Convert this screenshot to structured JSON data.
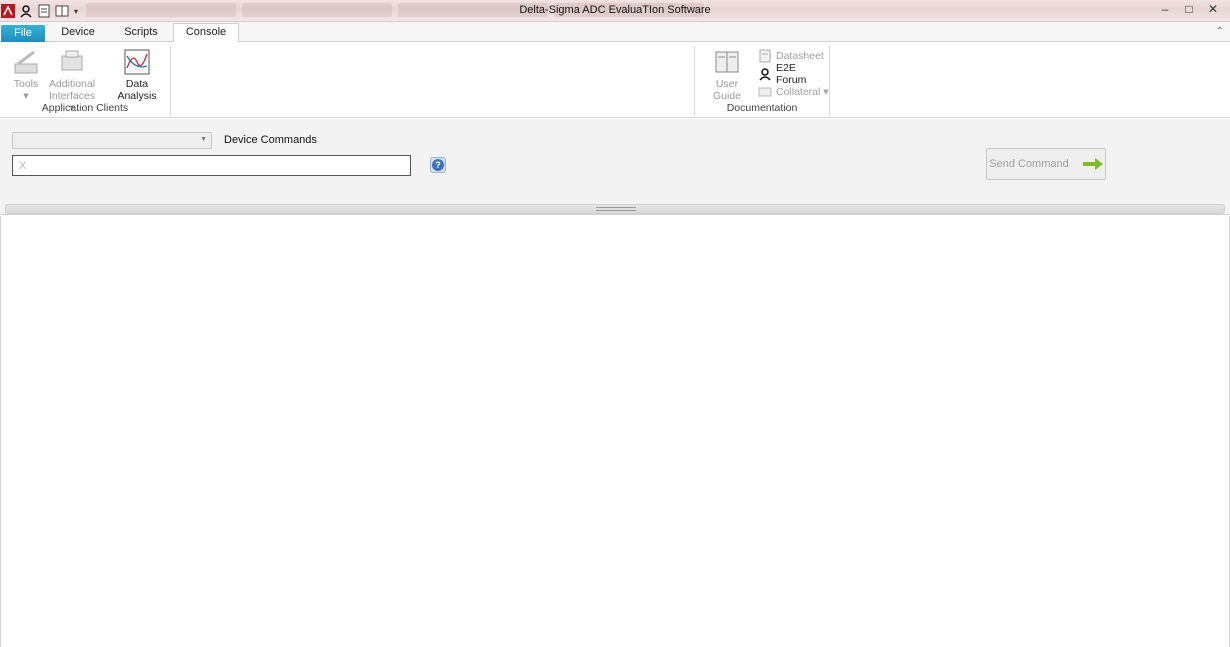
{
  "window": {
    "title": "Delta-Sigma ADC EvaluaTIon Software",
    "controls": [
      "minimize",
      "maximize",
      "close"
    ]
  },
  "quick_access": [
    "acrobat-icon",
    "user-icon",
    "document-icon",
    "book-icon"
  ],
  "tabs": [
    {
      "label": "File"
    },
    {
      "label": "Device"
    },
    {
      "label": "Scripts"
    },
    {
      "label": "Console"
    }
  ],
  "ribbon": {
    "app_clients": {
      "label": "Application Clients",
      "tools": {
        "line1": "Tools",
        "line2": "▾"
      },
      "additional": {
        "line1": "Additional",
        "line2": "Interfaces ▾"
      },
      "data_analysis": {
        "line1": "Data",
        "line2": "Analysis"
      }
    },
    "documentation": {
      "label": "Documentation",
      "user_guide": {
        "line1": "User",
        "line2": "Guide"
      },
      "datasheet": "Datasheet",
      "e2e": "E2E Forum",
      "collateral": "Collateral ▾"
    }
  },
  "command_panel": {
    "device_commands_label": "Device Commands",
    "input_placeholder": "X",
    "input_value": "",
    "help": "?",
    "send_label": "Send Command"
  },
  "colors": {
    "file_tab": "#1c8fbf",
    "send_arrow": "#7cbf1e"
  }
}
